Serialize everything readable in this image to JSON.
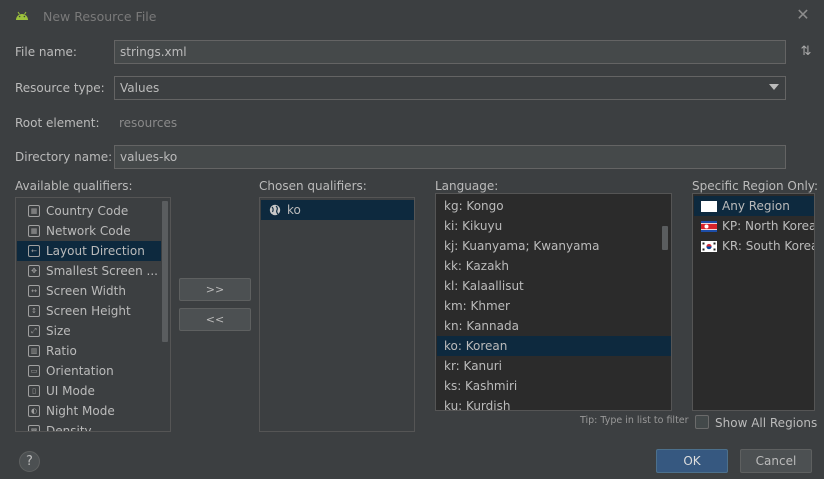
{
  "window": {
    "title": "New Resource File",
    "close_icon": "close-icon"
  },
  "form": {
    "file_name_label": "File name:",
    "file_name_value": "strings.xml",
    "resource_type_label": "Resource type:",
    "resource_type_value": "Values",
    "root_element_label": "Root element:",
    "root_element_value": "resources",
    "directory_name_label": "Directory name:",
    "directory_name_value": "values-ko"
  },
  "available": {
    "label": "Available qualifiers:",
    "items": [
      {
        "label": "Country Code",
        "icon": "country-code-icon"
      },
      {
        "label": "Network Code",
        "icon": "network-code-icon"
      },
      {
        "label": "Layout Direction",
        "icon": "layout-direction-icon",
        "selected": true
      },
      {
        "label": "Smallest Screen ...",
        "icon": "smallest-screen-icon"
      },
      {
        "label": "Screen Width",
        "icon": "screen-width-icon"
      },
      {
        "label": "Screen Height",
        "icon": "screen-height-icon"
      },
      {
        "label": "Size",
        "icon": "size-icon"
      },
      {
        "label": "Ratio",
        "icon": "ratio-icon"
      },
      {
        "label": "Orientation",
        "icon": "orientation-icon"
      },
      {
        "label": "UI Mode",
        "icon": "ui-mode-icon"
      },
      {
        "label": "Night Mode",
        "icon": "night-mode-icon"
      },
      {
        "label": "Density",
        "icon": "density-icon"
      }
    ]
  },
  "move_buttons": {
    "add": ">>",
    "remove": "<<"
  },
  "chosen": {
    "label": "Chosen qualifiers:",
    "items": [
      {
        "label": "ko",
        "icon": "globe-icon"
      }
    ]
  },
  "language": {
    "label": "Language:",
    "items": [
      "kg: Kongo",
      "ki: Kikuyu",
      "kj: Kuanyama; Kwanyama",
      "kk: Kazakh",
      "kl: Kalaallisut",
      "km: Khmer",
      "kn: Kannada",
      "ko: Korean",
      "kr: Kanuri",
      "ks: Kashmiri",
      "ku: Kurdish"
    ],
    "selected_index": 7,
    "tip": "Tip: Type in list to filter"
  },
  "region": {
    "label": "Specific Region Only:",
    "items": [
      {
        "label": "Any Region",
        "flag": "blank-flag-icon"
      },
      {
        "label": "KP: North Korea",
        "flag": "north-korea-flag-icon"
      },
      {
        "label": "KR: South Korea",
        "flag": "south-korea-flag-icon"
      }
    ],
    "show_all_label": "Show All Regions"
  },
  "footer": {
    "help": "?",
    "ok": "OK",
    "cancel": "Cancel"
  }
}
